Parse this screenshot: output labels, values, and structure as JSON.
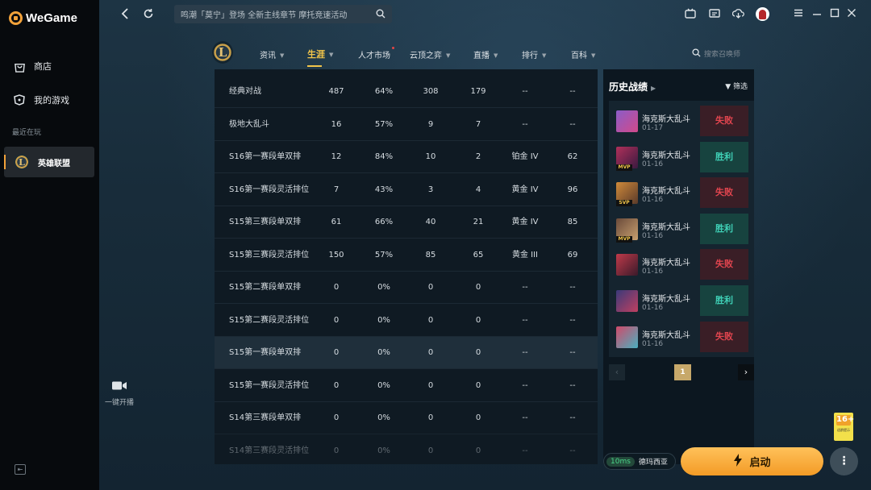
{
  "app": {
    "name": "WeGame"
  },
  "sidebar": {
    "items": [
      {
        "label": "商店",
        "icon": "shopping-bag-icon"
      },
      {
        "label": "我的游戏",
        "icon": "gamepad-icon"
      }
    ],
    "recent_label": "最近在玩",
    "recent_game": "英雄联盟",
    "stream_label": "一键开播"
  },
  "topbar": {
    "search_placeholder": "鸣潮「莫宁」登场 全新主线章节 摩托竞速活动"
  },
  "gamenav": {
    "tabs": [
      {
        "label": "资讯",
        "has_caret": true
      },
      {
        "label": "生涯",
        "has_caret": true,
        "active": true
      },
      {
        "label": "人才市场",
        "has_dot": true
      },
      {
        "label": "云顶之弈",
        "has_caret": true
      },
      {
        "label": "直播",
        "has_caret": true
      },
      {
        "label": "排行",
        "has_caret": true
      },
      {
        "label": "百科",
        "has_caret": true
      }
    ],
    "summoner_search_placeholder": "搜索召唤师"
  },
  "stats_table": {
    "rows": [
      [
        "经典对战",
        "487",
        "64%",
        "308",
        "179",
        "--",
        "--"
      ],
      [
        "极地大乱斗",
        "16",
        "57%",
        "9",
        "7",
        "--",
        "--"
      ],
      [
        "S16第一赛段单双排",
        "12",
        "84%",
        "10",
        "2",
        "铂金 IV",
        "62"
      ],
      [
        "S16第一赛段灵活排位",
        "7",
        "43%",
        "3",
        "4",
        "黄金 IV",
        "96"
      ],
      [
        "S15第三赛段单双排",
        "61",
        "66%",
        "40",
        "21",
        "黄金 IV",
        "85"
      ],
      [
        "S15第三赛段灵活排位",
        "150",
        "57%",
        "85",
        "65",
        "黄金 III",
        "69"
      ],
      [
        "S15第二赛段单双排",
        "0",
        "0%",
        "0",
        "0",
        "--",
        "--"
      ],
      [
        "S15第二赛段灵活排位",
        "0",
        "0%",
        "0",
        "0",
        "--",
        "--"
      ],
      [
        "S15第一赛段单双排",
        "0",
        "0%",
        "0",
        "0",
        "--",
        "--"
      ],
      [
        "S15第一赛段灵活排位",
        "0",
        "0%",
        "0",
        "0",
        "--",
        "--"
      ],
      [
        "S14第三赛段单双排",
        "0",
        "0%",
        "0",
        "0",
        "--",
        "--"
      ],
      [
        "S14第三赛段灵活排位",
        "0",
        "0%",
        "0",
        "0",
        "--",
        "--"
      ]
    ],
    "highlighted_row": 8
  },
  "history": {
    "title": "历史战绩",
    "filter_label": "筛选",
    "matches": [
      {
        "mode": "海克斯大乱斗",
        "date": "01-17",
        "result": "失败",
        "win": false,
        "badge": "",
        "colors": [
          "#8a5cc8",
          "#d24a8a"
        ]
      },
      {
        "mode": "海克斯大乱斗",
        "date": "01-16",
        "result": "胜利",
        "win": true,
        "badge": "MVP",
        "colors": [
          "#b0305a",
          "#3a1a40"
        ]
      },
      {
        "mode": "海克斯大乱斗",
        "date": "01-16",
        "result": "失败",
        "win": false,
        "badge": "SVP",
        "colors": [
          "#d08a3a",
          "#5a3a2a"
        ]
      },
      {
        "mode": "海克斯大乱斗",
        "date": "01-16",
        "result": "胜利",
        "win": true,
        "badge": "MVP",
        "colors": [
          "#6a4a3a",
          "#c8a070"
        ]
      },
      {
        "mode": "海克斯大乱斗",
        "date": "01-16",
        "result": "失败",
        "win": false,
        "badge": "",
        "colors": [
          "#c03a4a",
          "#3a1a2a"
        ]
      },
      {
        "mode": "海克斯大乱斗",
        "date": "01-16",
        "result": "胜利",
        "win": true,
        "badge": "",
        "colors": [
          "#3a3a7a",
          "#c04060"
        ]
      },
      {
        "mode": "海克斯大乱斗",
        "date": "01-16",
        "result": "失败",
        "win": false,
        "badge": "",
        "colors": [
          "#d04a6a",
          "#4ab0c0"
        ]
      }
    ],
    "page": "1"
  },
  "footer": {
    "age_rating": "16+",
    "age_rating_note": "适龄提示",
    "ping": "10ms",
    "server": "德玛西亚",
    "launch_label": "启动"
  },
  "colors": {
    "accent": "#f2c54a",
    "win": "#3fd0b6",
    "lose": "#e2454f",
    "launch": "#f39b26"
  }
}
